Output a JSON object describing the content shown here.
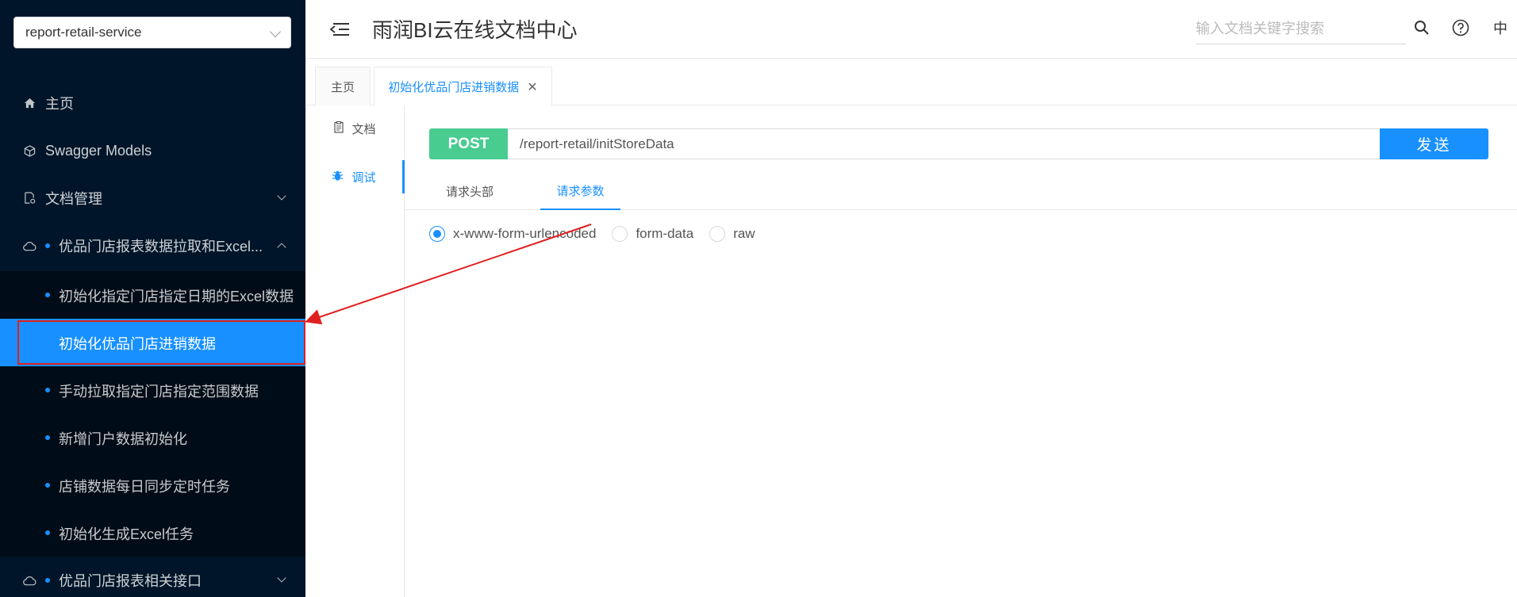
{
  "sidebar": {
    "service_select": "report-retail-service",
    "menu": [
      {
        "label": "主页",
        "icon": "home-icon"
      },
      {
        "label": "Swagger Models",
        "icon": "cube-icon"
      },
      {
        "label": "文档管理",
        "icon": "doc-settings-icon"
      },
      {
        "label": "优品门店报表数据拉取和Excel...",
        "icon": "cloud-icon"
      },
      {
        "label": "优品门店报表相关接口",
        "icon": "cloud-icon"
      }
    ],
    "sub_items": [
      {
        "label": "初始化指定门店指定日期的Excel数据"
      },
      {
        "label": "初始化优品门店进销数据"
      },
      {
        "label": "手动拉取指定门店指定范围数据"
      },
      {
        "label": "新增门户数据初始化"
      },
      {
        "label": "店铺数据每日同步定时任务"
      },
      {
        "label": "初始化生成Excel任务"
      }
    ]
  },
  "header": {
    "title": "雨润BI云在线文档中心",
    "search_placeholder": "输入文档关键字搜索",
    "lang": "中"
  },
  "tabs": [
    {
      "label": "主页"
    },
    {
      "label": "初始化优品门店进销数据"
    }
  ],
  "mini_nav": [
    {
      "label": "文档",
      "icon": "document-icon"
    },
    {
      "label": "调试",
      "icon": "bug-icon"
    }
  ],
  "request": {
    "method": "POST",
    "url": "/report-retail/initStoreData",
    "send_label": "发送"
  },
  "subtabs": [
    {
      "label": "请求头部"
    },
    {
      "label": "请求参数"
    }
  ],
  "body_types": [
    {
      "label": "x-www-form-urlencoded",
      "checked": true
    },
    {
      "label": "form-data",
      "checked": false
    },
    {
      "label": "raw",
      "checked": false
    }
  ],
  "colors": {
    "sidebar_bg": "#001529",
    "accent": "#1890ff",
    "post_green": "#49cc90",
    "annotation_red": "#e02020"
  }
}
